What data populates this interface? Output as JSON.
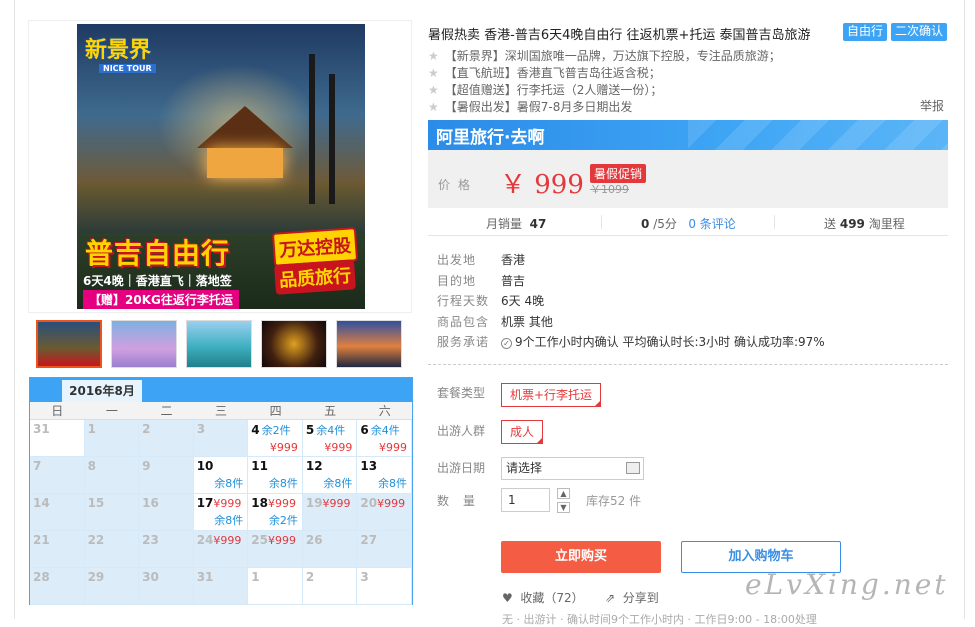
{
  "product": {
    "title": "暑假热卖 香港-普吉6天4晚自由行 往返机票+托运 泰国普吉岛旅游",
    "tags": [
      "自由行",
      "二次确认"
    ],
    "bullets": [
      "【新景界】深圳国旅唯一品牌，万达旗下控股，专注品质旅游；",
      "【直飞航班】香港直飞普吉岛往返含税；",
      "【超值赠送】行李托运（2人赠送一份）；",
      "【暑假出发】暑假7-8月多日期出发"
    ],
    "report_label": "举报"
  },
  "image": {
    "brand": "新景界",
    "brand_sub": "NICE TOUR",
    "promo_title": "普吉自由行",
    "badge1": "万达控股",
    "badge2": "品质旅行",
    "promo_line": "6天4晚｜香港直飞｜落地签",
    "promo_gift": "【赠】20KG往返行李托运"
  },
  "shop": {
    "name": "阿里旅行·去啊"
  },
  "price": {
    "label": "价格",
    "current": "￥ 999",
    "promo": "暑假促销",
    "original": "￥1099"
  },
  "stats": {
    "monthly_label": "月销量",
    "monthly_value": "47",
    "rating_value": "0",
    "rating_suffix": "/5分",
    "reviews": "0 条评论",
    "points_prefix": "送",
    "points_value": "499",
    "points_suffix": "淘里程"
  },
  "details": [
    {
      "k": "出发地",
      "v": "香港"
    },
    {
      "k": "目的地",
      "v": "普吉"
    },
    {
      "k": "行程天数",
      "v": "6天 4晚"
    },
    {
      "k": "商品包含",
      "v": "机票  其他"
    },
    {
      "k": "服务承诺",
      "v": "9个工作小时内确认    平均确认时长:3小时    确认成功率:97%"
    }
  ],
  "options": {
    "package_label": "套餐类型",
    "package_value": "机票+行李托运",
    "people_label": "出游人群",
    "people_value": "成人",
    "date_label": "出游日期",
    "date_placeholder": "请选择",
    "qty_label": "数量",
    "qty_value": "1",
    "stock": "库存52 件"
  },
  "actions": {
    "buy": "立即购买",
    "cart": "加入购物车",
    "fav": "收藏（72）",
    "share": "分享到"
  },
  "watermark": "eLvXing.net",
  "footline": "无 · 出游计 · 确认时间9个工作小时内 · 工作日9:00 - 18:00处理",
  "calendar": {
    "month": "2016年8月",
    "dow": [
      "日",
      "一",
      "二",
      "三",
      "四",
      "五",
      "六"
    ],
    "rows": [
      [
        {
          "d": "31",
          "type": "white"
        },
        {
          "d": "1",
          "type": "grey"
        },
        {
          "d": "2",
          "type": "grey"
        },
        {
          "d": "3",
          "type": "grey"
        },
        {
          "d": "4",
          "type": "avail",
          "stock": "余2件",
          "price": "¥999"
        },
        {
          "d": "5",
          "type": "avail",
          "stock": "余4件",
          "price": "¥999"
        },
        {
          "d": "6",
          "type": "avail",
          "stock": "余4件",
          "price": "¥999"
        }
      ],
      [
        {
          "d": "7",
          "type": "grey"
        },
        {
          "d": "8",
          "type": "grey"
        },
        {
          "d": "9",
          "type": "grey"
        },
        {
          "d": "10",
          "type": "avail",
          "stock2": "余8件"
        },
        {
          "d": "11",
          "type": "avail",
          "stock2": "余8件"
        },
        {
          "d": "12",
          "type": "avail",
          "stock2": "余8件"
        },
        {
          "d": "13",
          "type": "avail",
          "stock2": "余8件"
        }
      ],
      [
        {
          "d": "14",
          "type": "grey"
        },
        {
          "d": "15",
          "type": "grey"
        },
        {
          "d": "16",
          "type": "grey"
        },
        {
          "d": "17",
          "type": "avail",
          "price_top": "¥999",
          "stock2": "余8件"
        },
        {
          "d": "18",
          "type": "avail",
          "price_top": "¥999",
          "stock2": "余2件"
        },
        {
          "d": "19",
          "type": "grey",
          "price_top": "¥999"
        },
        {
          "d": "20",
          "type": "grey",
          "price_top": "¥999"
        }
      ],
      [
        {
          "d": "21",
          "type": "grey"
        },
        {
          "d": "22",
          "type": "grey"
        },
        {
          "d": "23",
          "type": "grey"
        },
        {
          "d": "24",
          "type": "grey",
          "price_top": "¥999"
        },
        {
          "d": "25",
          "type": "grey",
          "price_top": "¥999"
        },
        {
          "d": "26",
          "type": "grey"
        },
        {
          "d": "27",
          "type": "grey"
        }
      ],
      [
        {
          "d": "28",
          "type": "grey"
        },
        {
          "d": "29",
          "type": "grey"
        },
        {
          "d": "30",
          "type": "grey"
        },
        {
          "d": "31",
          "type": "grey"
        },
        {
          "d": "1",
          "type": "white"
        },
        {
          "d": "2",
          "type": "white"
        },
        {
          "d": "3",
          "type": "white"
        }
      ]
    ]
  },
  "colors": {
    "accent": "#3da4f5",
    "price": "#e4393c",
    "buy": "#f45c44"
  }
}
